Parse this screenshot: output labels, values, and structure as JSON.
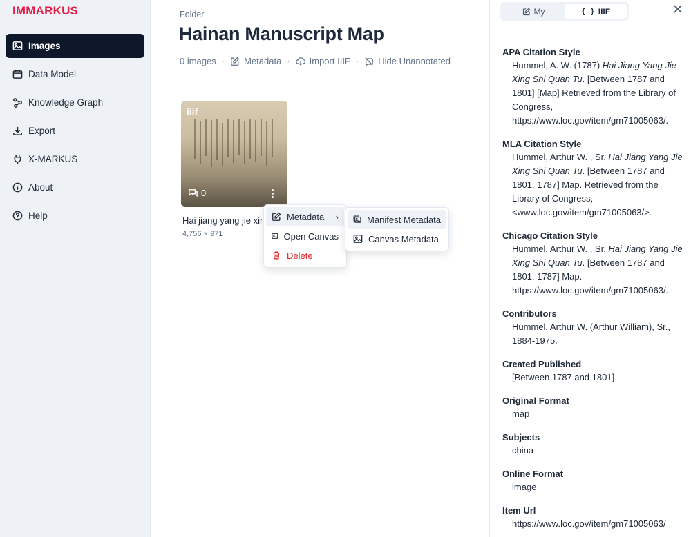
{
  "app": {
    "brand": "IMMARKUS"
  },
  "sidebar": {
    "items": [
      {
        "label": "Images",
        "icon": "image-icon",
        "active": true
      },
      {
        "label": "Data Model",
        "icon": "calendar-icon"
      },
      {
        "label": "Knowledge Graph",
        "icon": "graph-icon"
      },
      {
        "label": "Export",
        "icon": "download-icon"
      },
      {
        "label": "X-MARKUS",
        "icon": "plug-icon"
      },
      {
        "label": "About",
        "icon": "info-icon"
      },
      {
        "label": "Help",
        "icon": "help-icon"
      }
    ]
  },
  "main": {
    "breadcrumb": "Folder",
    "title": "Hainan Manuscript Map",
    "toolbar": {
      "images_count": "0 images",
      "metadata": "Metadata",
      "import": "Import IIIF",
      "hide": "Hide Unannotated"
    },
    "card": {
      "badge": "iiif",
      "comments": "0",
      "name": "Hai jiang yang jie xing shi quan tu",
      "dims": "4,756 × 971"
    }
  },
  "context_menu": {
    "items": [
      {
        "label": "Metadata",
        "icon": "edit-icon",
        "has_submenu": true
      },
      {
        "label": "Open Canvas",
        "icon": "image-icon"
      },
      {
        "label": "Delete",
        "icon": "trash-icon",
        "danger": true
      }
    ],
    "submenu": [
      {
        "label": "Manifest Metadata",
        "icon": "images-icon"
      },
      {
        "label": "Canvas Metadata",
        "icon": "image-icon"
      }
    ]
  },
  "panel": {
    "tabs": [
      {
        "label": "My",
        "icon": "edit-icon"
      },
      {
        "label": "IIIF",
        "icon": "braces-icon",
        "active": true
      }
    ],
    "metadata": {
      "apa": {
        "label": "APA Citation Style",
        "pre": "Hummel, A. W. (1787) ",
        "ital": "Hai Jiang Yang Jie Xing Shi Quan Tu",
        "post": ". [Between 1787 and 1801] [Map] Retrieved from the Library of Congress, https://www.loc.gov/item/gm71005063/."
      },
      "mla": {
        "label": "MLA Citation Style",
        "pre": "Hummel, Arthur W. , Sr. ",
        "ital": "Hai Jiang Yang Jie Xing Shi Quan Tu",
        "post": ". [Between 1787 and 1801, 1787] Map. Retrieved from the Library of Congress, <www.loc.gov/item/gm71005063/>."
      },
      "chicago": {
        "label": "Chicago Citation Style",
        "pre": "Hummel, Arthur W. , Sr. ",
        "ital": "Hai Jiang Yang Jie Xing Shi Quan Tu",
        "post": ". [Between 1787 and 1801, 1787] Map. https://www.loc.gov/item/gm71005063/."
      },
      "contributors": {
        "label": "Contributors",
        "value": "Hummel, Arthur W. (Arthur William), Sr., 1884-1975."
      },
      "created": {
        "label": "Created Published",
        "value": "[Between 1787 and 1801]"
      },
      "format": {
        "label": "Original Format",
        "value": "map"
      },
      "subjects": {
        "label": "Subjects",
        "value": "china"
      },
      "online": {
        "label": "Online Format",
        "value": "image"
      },
      "url": {
        "label": "Item Url",
        "value": "https://www.loc.gov/item/gm71005063/"
      }
    }
  }
}
